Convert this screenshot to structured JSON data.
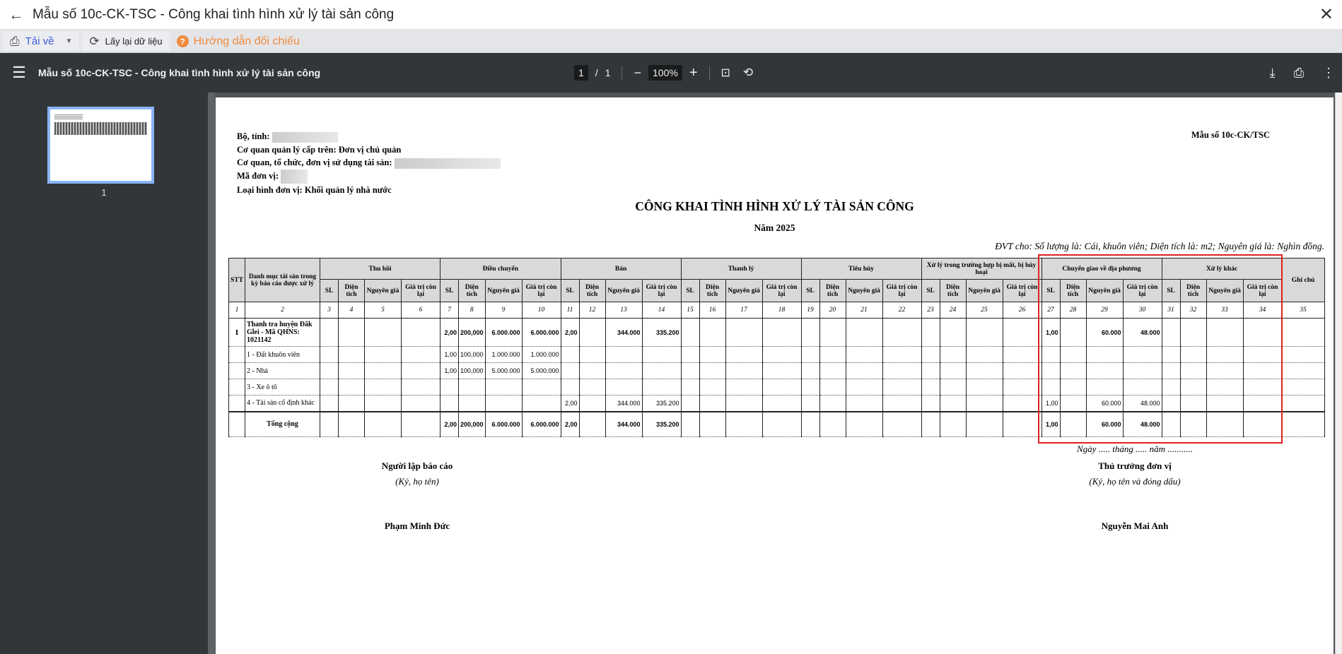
{
  "window": {
    "title": "Mẫu số 10c-CK-TSC - Công khai tình hình xử lý tài sản công",
    "back_icon": "arrow-left-icon",
    "close_icon": "close-icon"
  },
  "toolbar": {
    "download_label": "Tải về",
    "refresh_label": "Lấy lại dữ liệu",
    "help_label": "Hướng dẫn đối chiếu",
    "help_color": "#f08a3c",
    "accent": "#3b5bdb"
  },
  "pdf_viewer": {
    "title": "Mẫu số 10c-CK-TSC - Công khai tình hình xử lý tài sản công",
    "page_current": "1",
    "page_sep": "/",
    "page_total": "1",
    "zoom": "100%",
    "thumbnail_label": "1"
  },
  "document": {
    "info": {
      "bo_tinh": "Bộ, tỉnh:",
      "co_quan_cap_tren": "Cơ quan quản lý cấp trên: Đơn vị chủ quản",
      "co_quan_su_dung": "Cơ quan, tổ chức, đơn vị sử dụng tài sản:",
      "ma_don_vi": "Mã đơn vị:",
      "loai_hinh": "Loại hình đơn vị: Khối quản lý nhà nước"
    },
    "form_code": "Mẫu số 10c-CK/TSC",
    "title": "CÔNG KHAI TÌNH HÌNH XỬ LÝ TÀI SẢN CÔNG",
    "year": "Năm 2025",
    "unit_note": "ĐVT cho: Số lượng là: Cái, khuôn viên; Diện tích là: m2; Nguyên giá là: Nghìn đồng.",
    "table": {
      "stt_header": "STT",
      "item_header": "Danh mục tài sản trong kỳ báo cáo được xử lý",
      "note_header": "Ghi chú",
      "groups": [
        "Thu hồi",
        "Điều chuyển",
        "Bán",
        "Thanh lý",
        "Tiêu hủy",
        "Xử lý trong trường hợp bị mất, bị hủy hoại",
        "Chuyển giao về địa phương",
        "Xử lý khác"
      ],
      "sub_headers": [
        "SL",
        "Diện tích",
        "Nguyên giá",
        "Giá trị còn lại"
      ],
      "column_numbers": [
        "1",
        "2",
        "3",
        "4",
        "5",
        "6",
        "7",
        "8",
        "9",
        "10",
        "11",
        "12",
        "13",
        "14",
        "15",
        "16",
        "17",
        "18",
        "19",
        "20",
        "21",
        "22",
        "23",
        "24",
        "25",
        "26",
        "27",
        "28",
        "29",
        "30",
        "31",
        "32",
        "33",
        "34",
        "35"
      ],
      "rows": [
        {
          "kind": "unit",
          "cells": [
            "I",
            "Thanh tra huyện Đắk Glei - Mã QHNS: 1021142",
            "",
            "",
            "",
            "",
            "2,00",
            "200,000",
            "6.000.000",
            "6.000.000",
            "2,00",
            "",
            "344.000",
            "335.200",
            "",
            "",
            "",
            "",
            "",
            "",
            "",
            "",
            "",
            "",
            "",
            "",
            "1,00",
            "",
            "60.000",
            "48.000",
            "",
            "",
            "",
            "",
            ""
          ]
        },
        {
          "kind": "item",
          "cells": [
            "",
            "1 - Đất khuôn viên",
            "",
            "",
            "",
            "",
            "1,00",
            "100,000",
            "1.000.000",
            "1.000.000",
            "",
            "",
            "",
            "",
            "",
            "",
            "",
            "",
            "",
            "",
            "",
            "",
            "",
            "",
            "",
            "",
            "",
            "",
            "",
            "",
            "",
            "",
            "",
            "",
            ""
          ]
        },
        {
          "kind": "item",
          "cells": [
            "",
            "2 - Nhà",
            "",
            "",
            "",
            "",
            "1,00",
            "100,000",
            "5.000.000",
            "5.000.000",
            "",
            "",
            "",
            "",
            "",
            "",
            "",
            "",
            "",
            "",
            "",
            "",
            "",
            "",
            "",
            "",
            "",
            "",
            "",
            "",
            "",
            "",
            "",
            "",
            ""
          ]
        },
        {
          "kind": "item",
          "cells": [
            "",
            "3 - Xe ô tô",
            "",
            "",
            "",
            "",
            "",
            "",
            "",
            "",
            "",
            "",
            "",
            "",
            "",
            "",
            "",
            "",
            "",
            "",
            "",
            "",
            "",
            "",
            "",
            "",
            "",
            "",
            "",
            "",
            "",
            "",
            "",
            "",
            ""
          ]
        },
        {
          "kind": "item",
          "cells": [
            "",
            "4 - Tài sản cố định khác",
            "",
            "",
            "",
            "",
            "",
            "",
            "",
            "",
            "2,00",
            "",
            "344.000",
            "335.200",
            "",
            "",
            "",
            "",
            "",
            "",
            "",
            "",
            "",
            "",
            "",
            "",
            "1,00",
            "",
            "60.000",
            "48.000",
            "",
            "",
            "",
            "",
            ""
          ]
        },
        {
          "kind": "total",
          "cells": [
            "",
            "Tổng cộng",
            "",
            "",
            "",
            "",
            "2,00",
            "200,000",
            "6.000.000",
            "6.000.000",
            "2,00",
            "",
            "344.000",
            "335.200",
            "",
            "",
            "",
            "",
            "",
            "",
            "",
            "",
            "",
            "",
            "",
            "",
            "1,00",
            "",
            "60.000",
            "48.000",
            "",
            "",
            "",
            "",
            ""
          ]
        }
      ]
    },
    "date_line": "Ngày ..... tháng ..... năm ...........",
    "preparer": {
      "role": "Người lập báo cáo",
      "instruction": "(Ký, họ tên)",
      "name": "Phạm Minh Đức"
    },
    "head": {
      "role": "Thủ trưởng đơn vị",
      "instruction": "(Ký, họ tên và đóng dấu)",
      "name": "Nguyễn Mai Anh"
    },
    "highlight_color": "#e02020"
  }
}
